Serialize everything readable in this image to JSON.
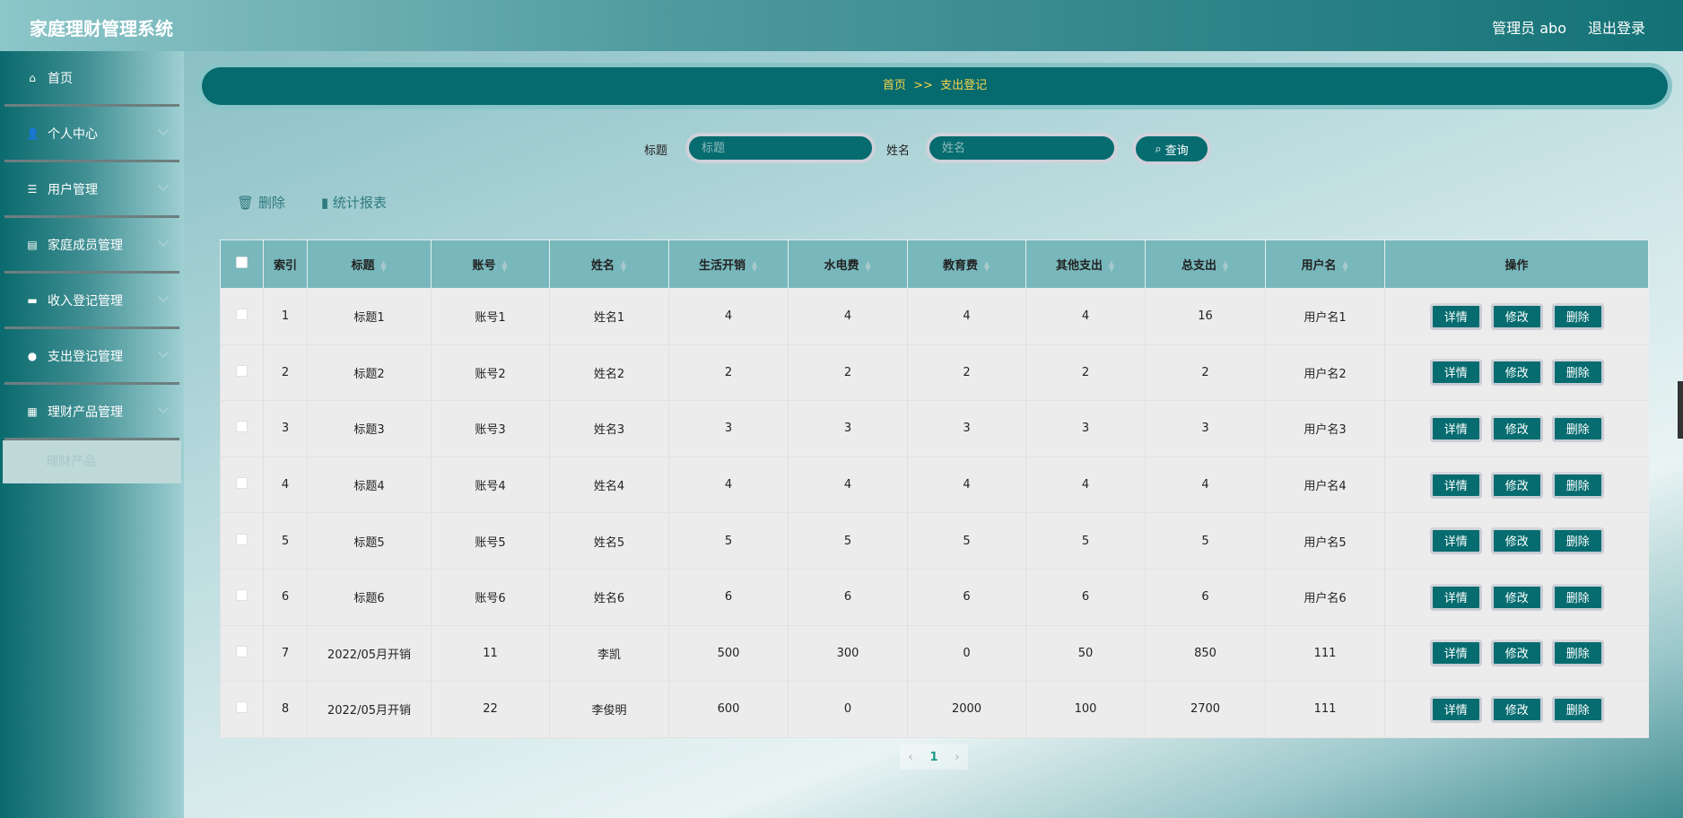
{
  "header": {
    "title": "家庭理财管理系统",
    "user": "管理员 abo",
    "logout": "退出登录"
  },
  "sidebar": {
    "items": [
      {
        "label": "首页",
        "icon": "home-icon",
        "glyph": "⌂",
        "expandable": false
      },
      {
        "label": "个人中心",
        "icon": "user-icon",
        "glyph": "👤",
        "expandable": true
      },
      {
        "label": "用户管理",
        "icon": "sliders-icon",
        "glyph": "☰",
        "expandable": true
      },
      {
        "label": "家庭成员管理",
        "icon": "clipboard-icon",
        "glyph": "▤",
        "expandable": true
      },
      {
        "label": "收入登记管理",
        "icon": "briefcase-icon",
        "glyph": "▬",
        "expandable": true
      },
      {
        "label": "支出登记管理",
        "icon": "bulb-icon",
        "glyph": "●",
        "expandable": true
      },
      {
        "label": "理财产品管理",
        "icon": "grid-icon",
        "glyph": "▦",
        "expandable": true
      }
    ],
    "submenu": "理财产品"
  },
  "breadcrumb": {
    "home": "首页",
    "sep": ">>",
    "current": "支出登记"
  },
  "search": {
    "title_label": "标题",
    "title_placeholder": "标题",
    "name_label": "姓名",
    "name_placeholder": "姓名",
    "button": "查询"
  },
  "toolbar": {
    "delete": "删除",
    "report": "统计报表"
  },
  "table": {
    "columns": [
      "索引",
      "标题",
      "账号",
      "姓名",
      "生活开销",
      "水电费",
      "教育费",
      "其他支出",
      "总支出",
      "用户名",
      "操作"
    ],
    "sortable": [
      false,
      true,
      true,
      true,
      true,
      true,
      true,
      true,
      true,
      true,
      false
    ],
    "rows": [
      [
        "1",
        "标题1",
        "账号1",
        "姓名1",
        "4",
        "4",
        "4",
        "4",
        "16",
        "用户名1"
      ],
      [
        "2",
        "标题2",
        "账号2",
        "姓名2",
        "2",
        "2",
        "2",
        "2",
        "2",
        "用户名2"
      ],
      [
        "3",
        "标题3",
        "账号3",
        "姓名3",
        "3",
        "3",
        "3",
        "3",
        "3",
        "用户名3"
      ],
      [
        "4",
        "标题4",
        "账号4",
        "姓名4",
        "4",
        "4",
        "4",
        "4",
        "4",
        "用户名4"
      ],
      [
        "5",
        "标题5",
        "账号5",
        "姓名5",
        "5",
        "5",
        "5",
        "5",
        "5",
        "用户名5"
      ],
      [
        "6",
        "标题6",
        "账号6",
        "姓名6",
        "6",
        "6",
        "6",
        "6",
        "6",
        "用户名6"
      ],
      [
        "7",
        "2022/05月开销",
        "11",
        "李凯",
        "500",
        "300",
        "0",
        "50",
        "850",
        "111"
      ],
      [
        "8",
        "2022/05月开销",
        "22",
        "李俊明",
        "600",
        "0",
        "2000",
        "100",
        "2700",
        "111"
      ]
    ],
    "actions": [
      "详情",
      "修改",
      "删除"
    ]
  },
  "pagination": {
    "current": "1",
    "prev": "‹",
    "next": "›"
  }
}
